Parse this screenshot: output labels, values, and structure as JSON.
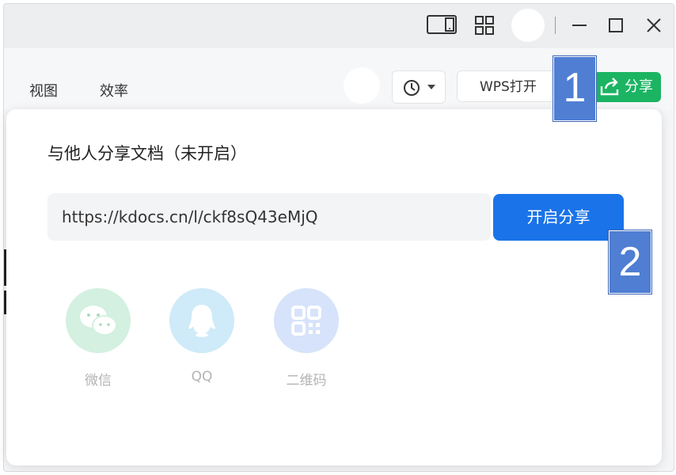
{
  "toolbar": {
    "menu_view": "视图",
    "menu_efficiency": "效率",
    "wps_open_label": "WPS打开",
    "share_label": "分享"
  },
  "popup": {
    "title": "与他人分享文档（未开启）",
    "link": "https://kdocs.cn/l/ckf8sQ43eMjQ",
    "enable_label": "开启分享",
    "options": [
      {
        "label": "微信",
        "icon": "wechat-icon"
      },
      {
        "label": "QQ",
        "icon": "qq-icon"
      },
      {
        "label": "二维码",
        "icon": "qrcode-icon"
      }
    ]
  },
  "markers": {
    "first": "1",
    "second": "2"
  },
  "colors": {
    "share_green": "#1bb463",
    "primary_blue": "#1a73e8",
    "marker_blue": "#4f7ed3"
  }
}
